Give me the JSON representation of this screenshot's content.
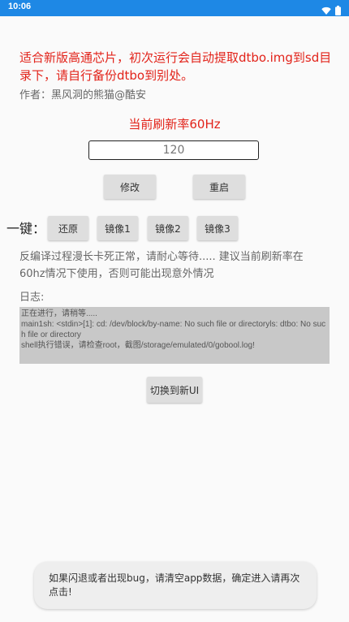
{
  "status_bar": {
    "time": "10:06",
    "icons": [
      "wifi-icon",
      "battery-icon"
    ],
    "color": "#1e88e5"
  },
  "notice": "适合新版高通芯片，初次运行会自动提取dtbo.img到sd目录下，请自行备份dtbo到别处。",
  "author": "作者：黑风洞的熊猫@酷安",
  "current_rate": "当前刷新率60Hz",
  "rate_input": {
    "value": "",
    "placeholder": "120"
  },
  "buttons": {
    "modify": "修改",
    "restart": "重启",
    "restore": "还原",
    "mirror1": "镜像1",
    "mirror2": "镜像2",
    "mirror3": "镜像3",
    "switch_ui": "切换到新UI"
  },
  "onekey_label": "一键：",
  "hint": "反编译过程漫长卡死正常，请耐心等待..... 建议当前刷新率在60hz情况下使用，否则可能出现意外情况",
  "log": {
    "label": "日志:",
    "lines": [
      "正在进行，请稍等.....",
      "main1sh: <stdin>[1]: cd: /dev/block/by-name: No such file or directoryls: dtbo: No such file or directory",
      "shell执行错误，请检查root，截图/storage/emulated/0/gobool.log!"
    ]
  },
  "toast": "如果闪退或者出现bug，请清空app数据，确定进入请再次点击!",
  "colors": {
    "accent_red": "#e2231a",
    "button_bg": "#dedede",
    "log_bg": "#c8c8c8"
  }
}
